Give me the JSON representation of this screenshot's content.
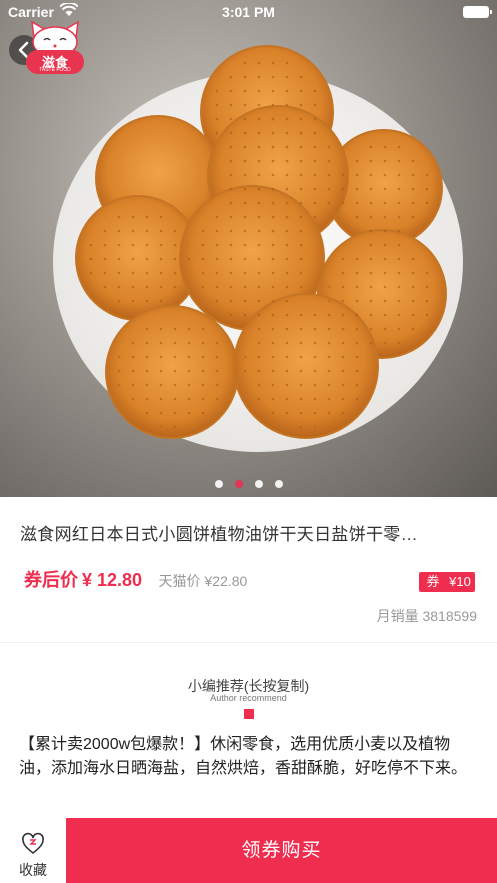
{
  "status_bar": {
    "carrier": "Carrier",
    "time": "3:01 PM"
  },
  "logo": {
    "text": "滋食",
    "subtext": "TASTE FOOD"
  },
  "carousel": {
    "count": 4,
    "active_index": 1
  },
  "product": {
    "title": "滋食网红日本日式小圆饼植物油饼干天日盐饼干零…",
    "price_label": "券后价",
    "price_value": "¥ 12.80",
    "original_label": "天猫价",
    "original_value": "¥22.80",
    "coupon_label": "券",
    "coupon_value": "¥10",
    "sales_text": "月销量 3818599"
  },
  "recommend": {
    "title": "小编推荐(长按复制)",
    "subtitle": "Author recommend",
    "body": "【累计卖2000w包爆款！】休闲零食，选用优质小麦以及植物油，添加海水日晒海盐，自然烘焙，香甜酥脆，好吃停不下来。"
  },
  "bottom_bar": {
    "favorite_label": "收藏",
    "buy_label": "领券购买"
  },
  "colors": {
    "accent": "#ee2d4f",
    "muted": "#999999"
  }
}
